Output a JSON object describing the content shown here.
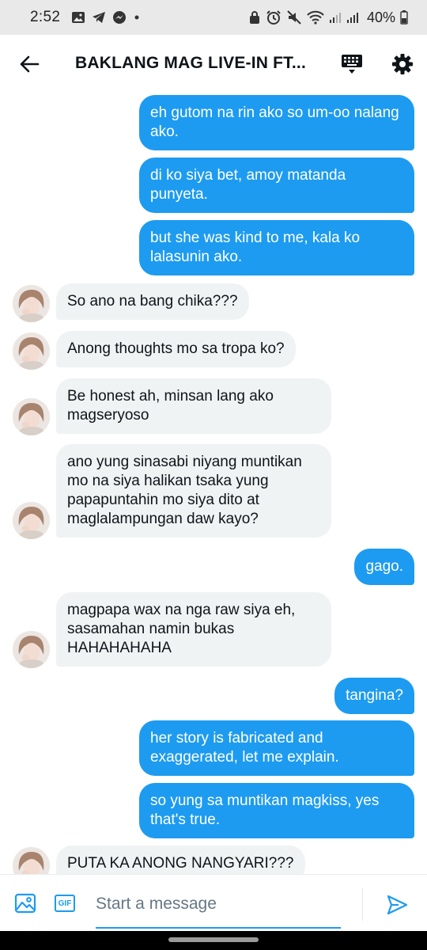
{
  "status_bar": {
    "time": "2:52",
    "left_icons": [
      "gallery-icon",
      "telegram-icon",
      "messenger-icon",
      "dot-icon"
    ],
    "right_icons": [
      "lock-icon",
      "alarm-icon",
      "mute-icon",
      "wifi-icon",
      "signal-icon",
      "signal-icon",
      "battery-icon"
    ],
    "battery": "40%"
  },
  "header": {
    "title": "BAKLANG MAG LIVE-IN FT..."
  },
  "messages": [
    {
      "side": "sent",
      "text": "eh gutom na rin ako so um-oo nalang ako."
    },
    {
      "side": "sent",
      "text": "di ko siya bet, amoy matanda punyeta."
    },
    {
      "side": "sent",
      "text": "but she was kind to me, kala ko lalasunin ako."
    },
    {
      "side": "received",
      "text": "So ano na bang chika???"
    },
    {
      "side": "received",
      "text": "Anong thoughts mo sa tropa ko?"
    },
    {
      "side": "received",
      "text": "Be honest ah, minsan lang ako magseryoso"
    },
    {
      "side": "received",
      "text": "ano yung sinasabi niyang muntikan mo na siya halikan tsaka yung papapuntahin mo siya dito at maglalampungan daw kayo?"
    },
    {
      "side": "sent",
      "text": "gago."
    },
    {
      "side": "received",
      "text": "magpapa wax na nga raw siya eh, sasamahan namin bukas HAHAHAHAHA"
    },
    {
      "side": "sent",
      "text": "tangina?"
    },
    {
      "side": "sent",
      "text": "her story is fabricated and exaggerated, let me explain."
    },
    {
      "side": "sent",
      "text": "so yung sa muntikan magkiss, yes that's true."
    },
    {
      "side": "received",
      "text": "PUTA KA ANONG NANGYARI???"
    }
  ],
  "composer": {
    "placeholder": "Start a message",
    "value": "",
    "gif_label": "GIF"
  },
  "colors": {
    "accent": "#1d9bf0",
    "received_bubble": "#eff3f4",
    "status_bar": "#e9e9e9"
  }
}
